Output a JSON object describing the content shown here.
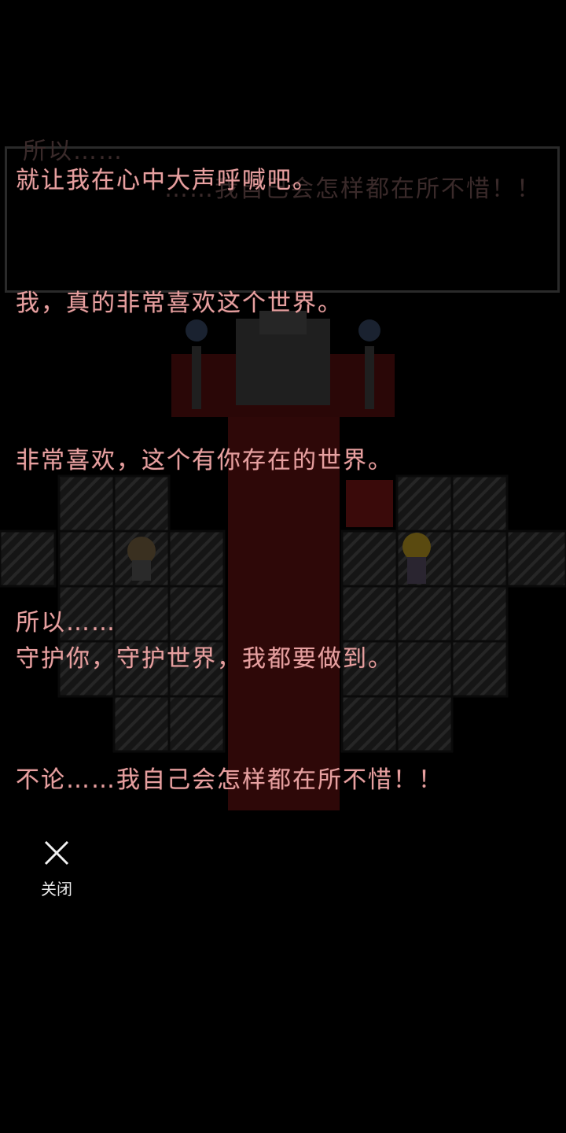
{
  "dialog": {
    "faded_top": "所以……",
    "current_line": "就让我在心中大声呼喊吧。",
    "faded_trailing": "……我自己会怎样都在所不惜！！"
  },
  "log_lines": [
    "我，真的非常喜欢这个世界。",
    "非常喜欢，这个有你存在的世界。",
    "所以……",
    "守护你，守护世界，我都要做到。",
    "不论……我自己会怎样都在所不惜！！"
  ],
  "close": {
    "label": "关闭",
    "icon": "close-icon"
  },
  "colors": {
    "text": "#e6a0a0",
    "carpet": "#4a0e0e",
    "tile": "#1a1a1a"
  }
}
